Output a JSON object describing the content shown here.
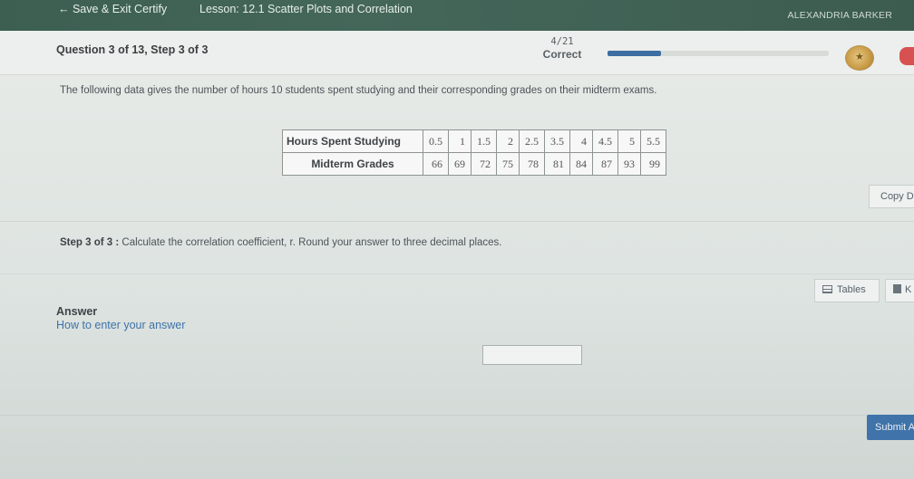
{
  "topbar": {
    "back_label": "← Save & Exit Certify",
    "lesson": "Lesson: 12.1 Scatter Plots and Correlation",
    "user": "ALEXANDRIA BARKER"
  },
  "question_header": {
    "question_number": "Question 3 of 13, Step 3 of 3",
    "score_fraction": "4/21",
    "score_status": "Correct",
    "progress_fraction": 0.24
  },
  "prompt": "The following data gives the number of hours 10 students spent studying and their corresponding grades on their midterm exams.",
  "data_table": {
    "rows": [
      {
        "header": "Hours Spent Studying",
        "values": [
          "0.5",
          "1",
          "1.5",
          "2",
          "2.5",
          "3.5",
          "4",
          "4.5",
          "5",
          "5.5"
        ]
      },
      {
        "header": "Midterm Grades",
        "values": [
          "66",
          "69",
          "72",
          "75",
          "78",
          "81",
          "84",
          "87",
          "93",
          "99"
        ]
      }
    ]
  },
  "copy_button": "Copy D",
  "step": {
    "label": "Step 3 of 3 :",
    "text": " Calculate the correlation coefficient, r. Round your answer to three decimal places."
  },
  "tools": {
    "tables_label": "Tables",
    "calc_label": "K"
  },
  "answer": {
    "label": "Answer",
    "help_link": "How to enter your answer",
    "value": ""
  },
  "submit_label": "Submit A",
  "colors": {
    "topbar": "#3c5f52",
    "link": "#3f73a9",
    "progress": "#3c6ea2",
    "submit": "#3f73a9"
  }
}
